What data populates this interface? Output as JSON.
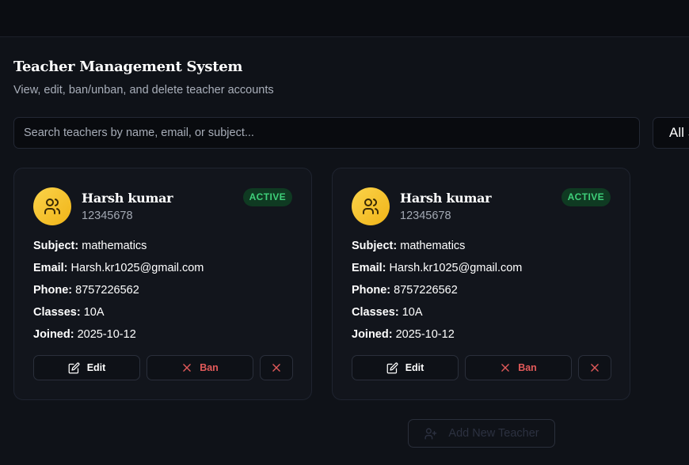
{
  "header": {
    "title": "Teacher Management System",
    "subtitle": "View, edit, ban/unban, and delete teacher accounts"
  },
  "search": {
    "placeholder": "Search teachers by name, email, or subject...",
    "value": ""
  },
  "filter": {
    "label": "All S"
  },
  "labels": {
    "subject": "Subject:",
    "email": "Email:",
    "phone": "Phone:",
    "classes": "Classes:",
    "joined": "Joined:",
    "edit": "Edit",
    "ban": "Ban"
  },
  "teachers": [
    {
      "name": "Harsh kumar",
      "id": "12345678",
      "status": "ACTIVE",
      "subject": "mathematics",
      "email": "Harsh.kr1025@gmail.com",
      "phone": "8757226562",
      "classes": "10A",
      "joined": "2025-10-12"
    },
    {
      "name": "Harsh kumar",
      "id": "12345678",
      "status": "ACTIVE",
      "subject": "mathematics",
      "email": "Harsh.kr1025@gmail.com",
      "phone": "8757226562",
      "classes": "10A",
      "joined": "2025-10-12"
    }
  ],
  "add_button": {
    "label": "Add New Teacher"
  },
  "colors": {
    "background": "#0f1218",
    "card": "#12151c",
    "avatar": "#f5c12a",
    "status_active": "#3fd07a",
    "danger": "#e25a5a"
  },
  "icons": {
    "avatar": "users-icon",
    "edit": "edit-icon",
    "ban": "x-icon",
    "delete": "x-icon",
    "add": "user-plus-icon"
  }
}
